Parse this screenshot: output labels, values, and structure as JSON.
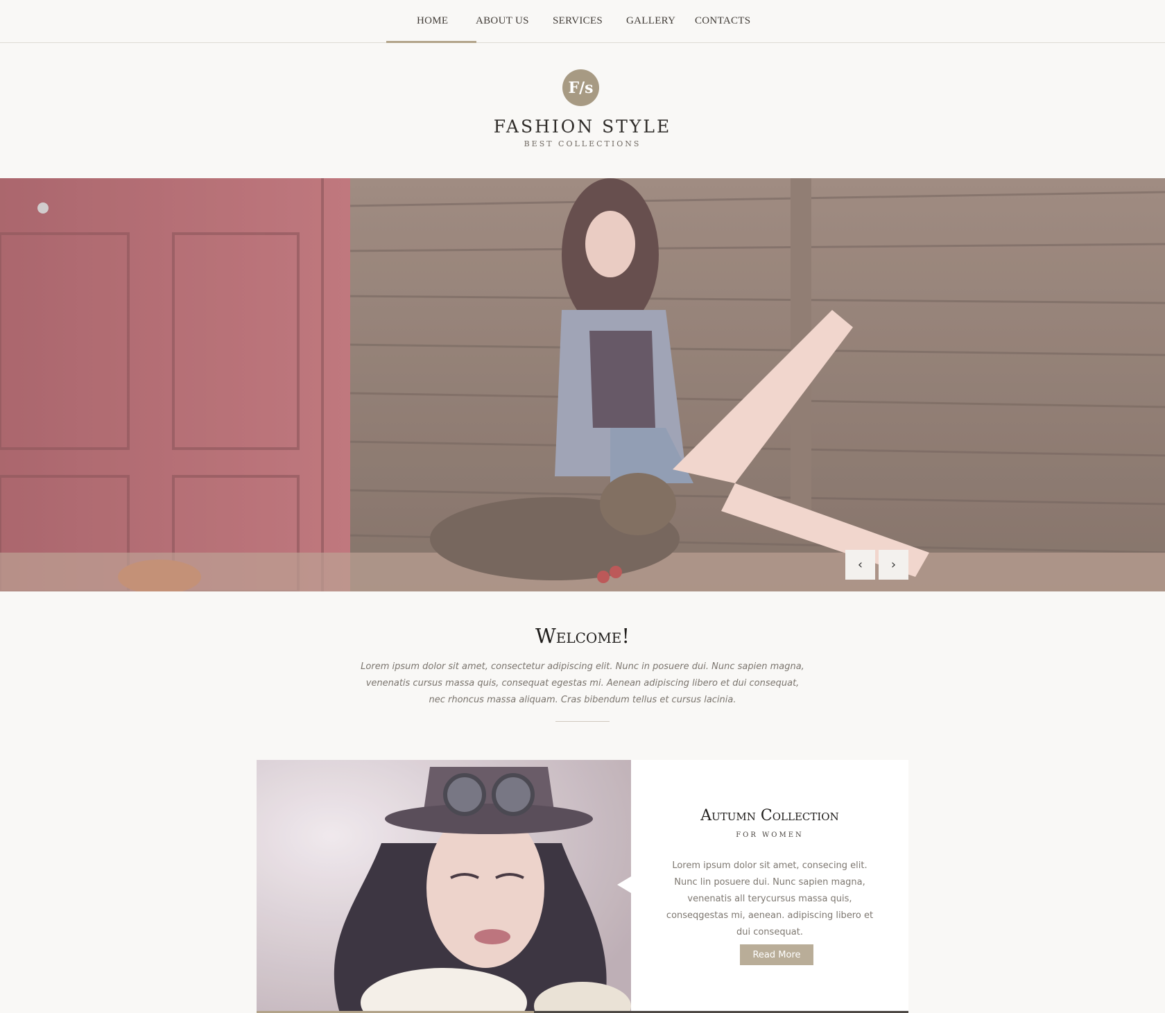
{
  "nav": {
    "items": [
      {
        "label": "HOME"
      },
      {
        "label": "ABOUT US"
      },
      {
        "label": "SERVICES"
      },
      {
        "label": "GALLERY"
      },
      {
        "label": "CONTACTS"
      }
    ],
    "active": "HOME"
  },
  "logo": {
    "mark": "F/s",
    "title": "FASHION STYLE",
    "subtitle": "BEST COLLECTIONS"
  },
  "slider": {
    "prev_icon": "chevron-left-icon",
    "next_icon": "chevron-right-icon"
  },
  "welcome": {
    "title": "Welcome!",
    "text": "Lorem ipsum dolor sit amet, consectetur adipiscing elit. Nunc in posuere dui. Nunc sapien magna, venenatis cursus massa quis, consequat egestas mi. Aenean adipiscing libero et dui consequat, nec rhoncus massa aliquam. Cras bibendum tellus et cursus lacinia."
  },
  "collection": {
    "title": "Autumn Collection",
    "subtitle": "FOR WOMEN",
    "text": "Lorem ipsum dolor sit amet, consecing elit. Nunc lin posuere dui. Nunc sapien magna, venenatis all terycursus massa quis, conseqgestas mi, aenean. adipiscing libero et dui consequat.",
    "button": "Read More"
  },
  "colors": {
    "accent": "#b2a389",
    "background": "#f9f8f6",
    "button": "#b9ad98"
  }
}
